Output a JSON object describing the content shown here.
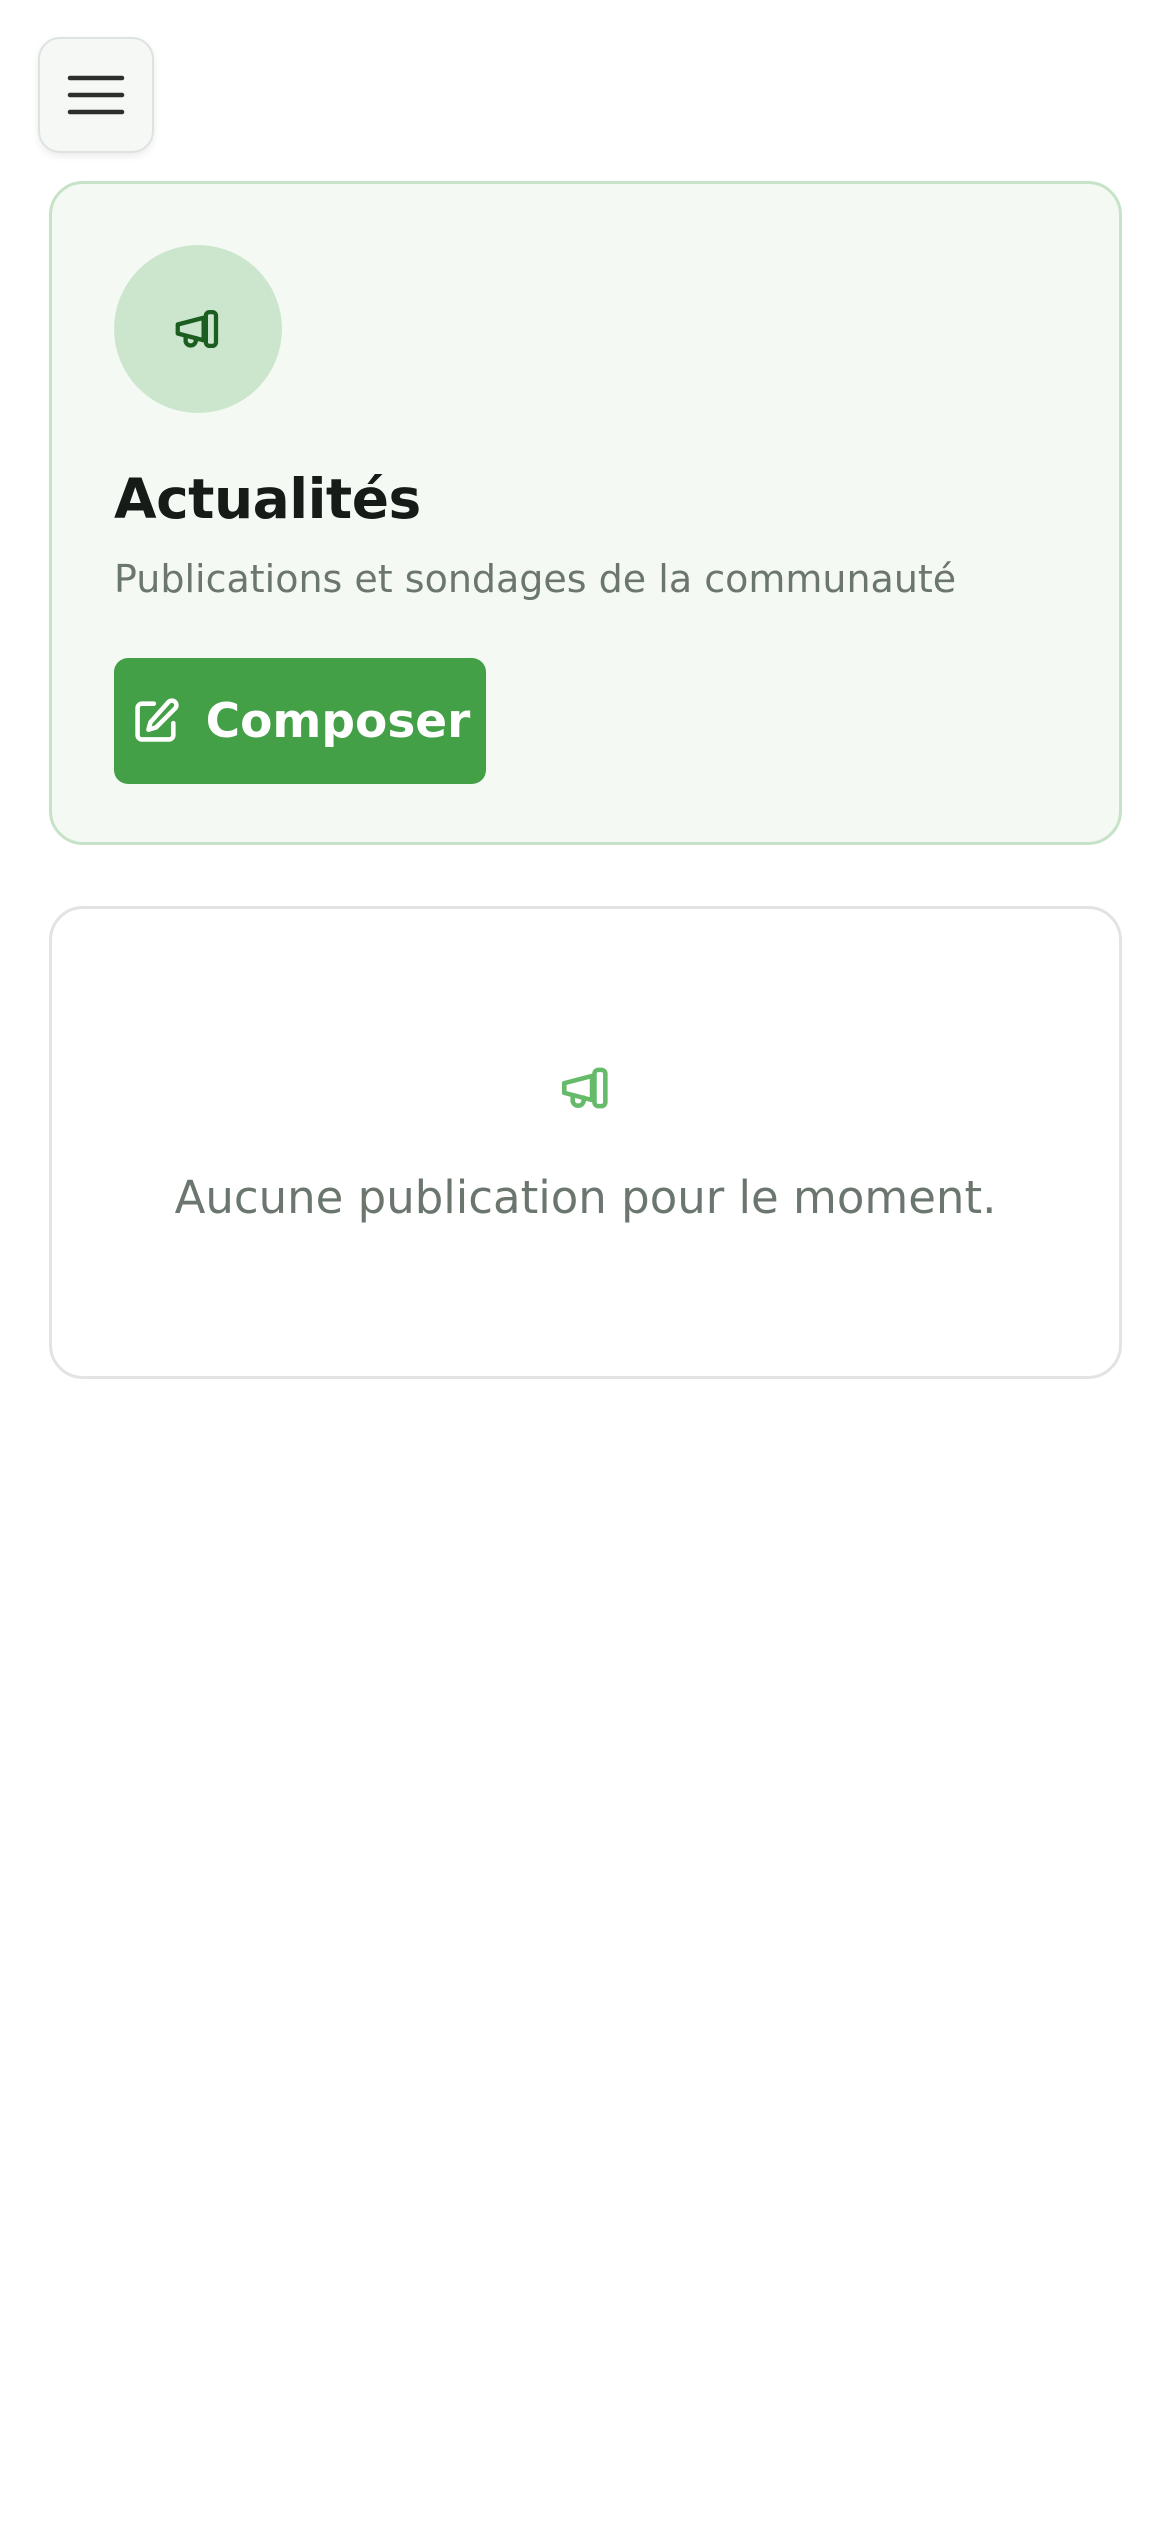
{
  "header": {
    "menu_icon": "hamburger-menu-icon"
  },
  "hero": {
    "icon": "megaphone-icon",
    "title": "Actualités",
    "subtitle": "Publications et sondages de la communauté",
    "compose_icon": "edit-square-icon",
    "compose_label": "Composer"
  },
  "feed": {
    "empty_icon": "megaphone-icon",
    "empty_message": "Aucune publication pour le moment."
  },
  "colors": {
    "accent": "#43a047",
    "accent_light": "#cce6cd",
    "hero_background": "#f4f9f4",
    "hero_border": "#c6e3c8",
    "muted_text": "#6b766e",
    "icon_dark_green": "#1b5e20",
    "icon_light_green": "#66bb6a"
  }
}
